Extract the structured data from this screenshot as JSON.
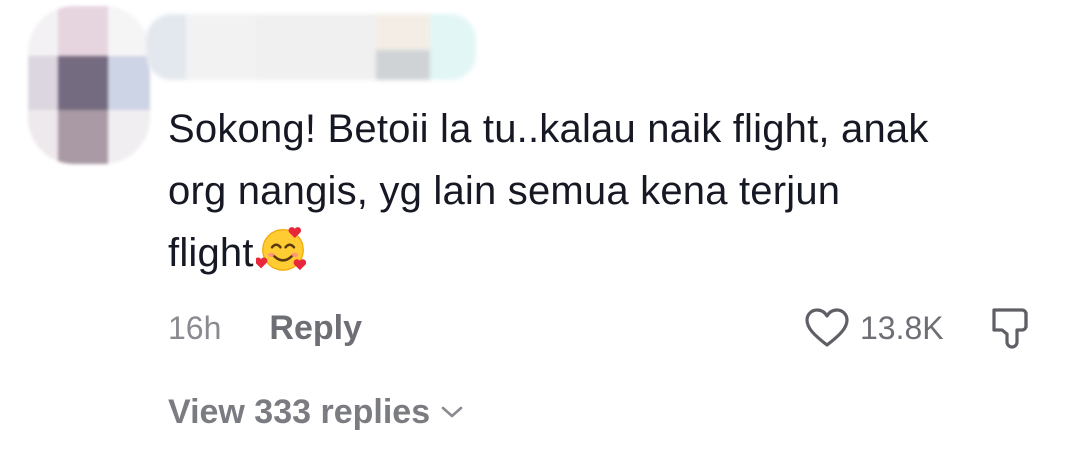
{
  "comment": {
    "text_line1": "Sokong! Betoii la tu..kalau naik flight, anak",
    "text_line2": "org nangis, yg lain semua kena terjun",
    "text_line3": "flight",
    "emoji_icon": "smiling-face-with-hearts-icon",
    "timestamp": "16h",
    "reply_label": "Reply",
    "like_count": "13.8K",
    "view_replies_label": "View 333 replies"
  },
  "colors": {
    "text_primary": "#161823",
    "text_secondary": "#8a8b91",
    "heart_stroke": "#5f6066"
  }
}
